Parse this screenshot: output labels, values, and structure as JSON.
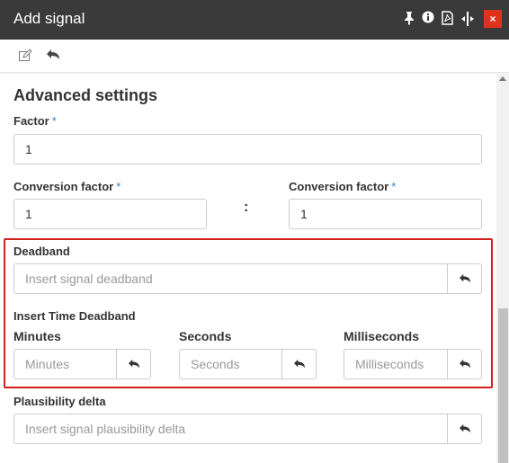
{
  "window": {
    "title": "Add signal",
    "icons": [
      "pin-icon",
      "info-icon",
      "pdf-icon",
      "resize-icon",
      "close-icon"
    ],
    "close_glyph": "×",
    "accent_color": "#e0321f"
  },
  "toolbar": {
    "icons": [
      "edit-icon",
      "undo-icon"
    ]
  },
  "form": {
    "section_title": "Advanced settings",
    "required_marker": "*",
    "factor": {
      "label": "Factor",
      "value": "1"
    },
    "conversion_left": {
      "label": "Conversion factor",
      "value": "1"
    },
    "separator": ":",
    "conversion_right": {
      "label": "Conversion factor",
      "value": "1"
    },
    "deadband": {
      "label": "Deadband",
      "placeholder": "Insert signal deadband"
    },
    "time_deadband": {
      "label": "Insert Time Deadband",
      "minutes": {
        "label": "Minutes",
        "placeholder": "Minutes"
      },
      "seconds": {
        "label": "Seconds",
        "placeholder": "Seconds"
      },
      "milliseconds": {
        "label": "Milliseconds",
        "placeholder": "Milliseconds"
      }
    },
    "plausibility": {
      "label": "Plausibility delta",
      "placeholder": "Insert signal plausibility delta"
    },
    "highlight_color": "#d02020",
    "required_color": "#2a7fd4"
  }
}
